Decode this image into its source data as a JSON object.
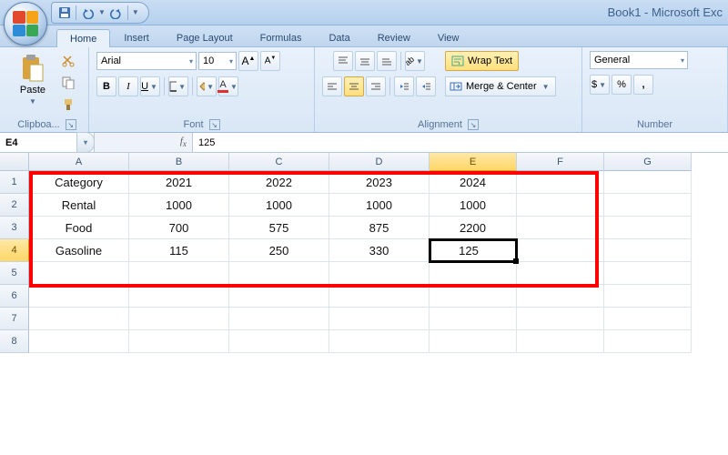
{
  "app": {
    "title": "Book1 - Microsoft Exc"
  },
  "qat": {
    "save": "save-icon",
    "undo": "undo-icon",
    "redo": "redo-icon"
  },
  "tabs": [
    {
      "label": "Home",
      "active": true
    },
    {
      "label": "Insert"
    },
    {
      "label": "Page Layout"
    },
    {
      "label": "Formulas"
    },
    {
      "label": "Data"
    },
    {
      "label": "Review"
    },
    {
      "label": "View"
    }
  ],
  "ribbon": {
    "clipboard": {
      "label": "Clipboa...",
      "paste": "Paste"
    },
    "font": {
      "label": "Font",
      "name": "Arial",
      "size": "10"
    },
    "alignment": {
      "label": "Alignment",
      "wrap": "Wrap Text",
      "merge": "Merge & Center"
    },
    "number": {
      "label": "Number",
      "format": "General"
    }
  },
  "namebox": "E4",
  "formula": "125",
  "columns": [
    "A",
    "B",
    "C",
    "D",
    "E",
    "F",
    "G"
  ],
  "active_col_index": 4,
  "active_row_index": 3,
  "active_cell": "E4",
  "rows": [
    [
      "Category",
      "2021",
      "2022",
      "2023",
      "2024",
      "",
      ""
    ],
    [
      "Rental",
      "1000",
      "1000",
      "1000",
      "1000",
      "",
      ""
    ],
    [
      "Food",
      "700",
      "575",
      "875",
      "2200",
      "",
      ""
    ],
    [
      "Gasoline",
      "115",
      "250",
      "330",
      "125",
      "",
      ""
    ],
    [
      "",
      "",
      "",
      "",
      "",
      "",
      ""
    ],
    [
      "",
      "",
      "",
      "",
      "",
      "",
      ""
    ],
    [
      "",
      "",
      "",
      "",
      "",
      "",
      ""
    ],
    [
      "",
      "",
      "",
      "",
      "",
      "",
      ""
    ]
  ],
  "icons": {
    "currency": "$",
    "percent": "%",
    "comma": ","
  }
}
